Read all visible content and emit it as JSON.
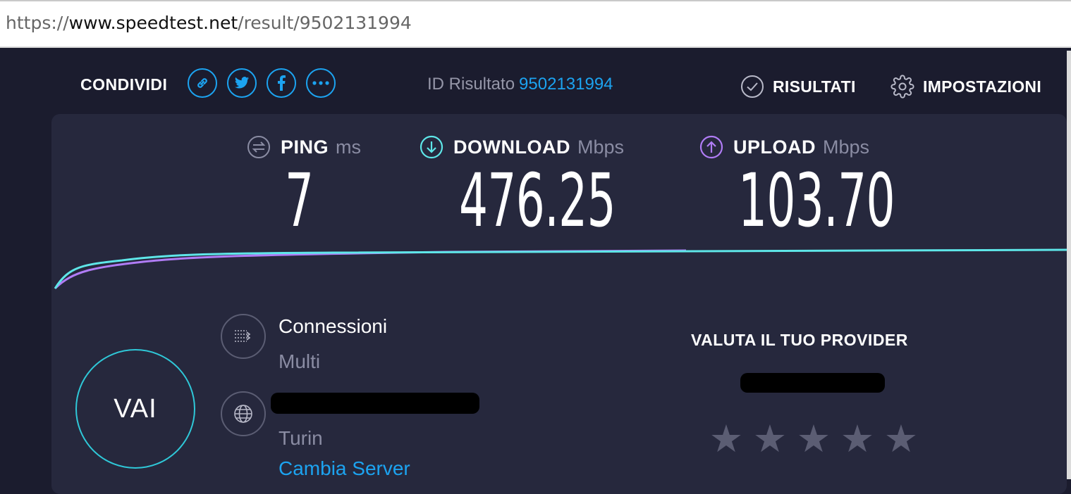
{
  "browser": {
    "url_scheme": "https://",
    "url_host": "www.speedtest.net",
    "url_path": "/result/9502131994"
  },
  "header": {
    "share_label": "CONDIVIDI",
    "share_icons": [
      "link-icon",
      "twitter-icon",
      "facebook-icon",
      "more-icon"
    ],
    "result_id_label": "ID Risultato",
    "result_id_value": "9502131994",
    "results_label": "RISULTATI",
    "settings_label": "IMPOSTAZIONI"
  },
  "metrics": {
    "ping": {
      "label": "PING",
      "unit": "ms",
      "value": "7",
      "icon": "ping-icon"
    },
    "download": {
      "label": "DOWNLOAD",
      "unit": "Mbps",
      "value": "476.25",
      "icon": "download-arrow-icon"
    },
    "upload": {
      "label": "UPLOAD",
      "unit": "Mbps",
      "value": "103.70",
      "icon": "upload-arrow-icon"
    }
  },
  "go_button_label": "VAI",
  "connection": {
    "title": "Connessioni",
    "value": "Multi"
  },
  "server": {
    "location": "Turin",
    "change_label": "Cambia Server"
  },
  "rating": {
    "title": "VALUTA IL TUO PROVIDER",
    "stars": 5
  },
  "colors": {
    "background": "#1b1c2e",
    "panel": "#26283d",
    "accent_blue": "#1ca3f0",
    "download_cyan": "#5ee6e8",
    "upload_purple": "#b07cf5"
  }
}
